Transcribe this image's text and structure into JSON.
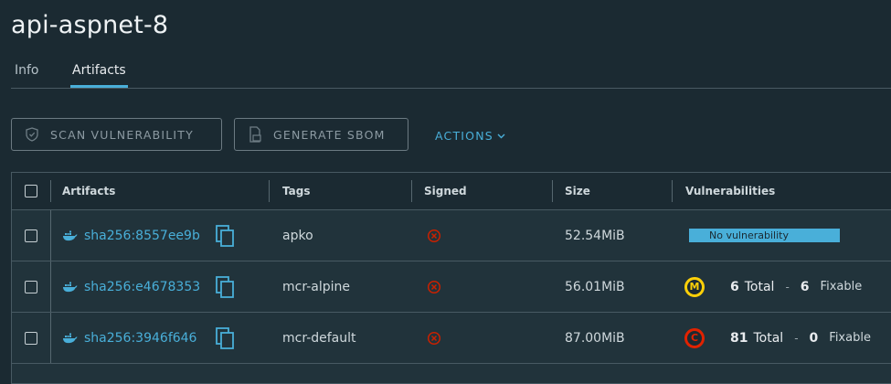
{
  "page": {
    "title": "api-aspnet-8"
  },
  "tabs": [
    {
      "label": "Info"
    },
    {
      "label": "Artifacts"
    }
  ],
  "toolbar": {
    "scan_label": "SCAN VULNERABILITY",
    "sbom_label": "GENERATE SBOM",
    "actions_label": "ACTIONS"
  },
  "table": {
    "headers": [
      "Artifacts",
      "Tags",
      "Signed",
      "Size",
      "Vulnerabilities"
    ],
    "rows": [
      {
        "digest": "sha256:8557ee9b",
        "tag": "apko",
        "size": "52.54MiB",
        "vuln": {
          "type": "none",
          "label": "No vulnerability"
        }
      },
      {
        "digest": "sha256:e4678353",
        "tag": "mcr-alpine",
        "size": "56.01MiB",
        "vuln": {
          "type": "medium",
          "severity": "M",
          "total": "6",
          "total_label": "Total",
          "dash": "-",
          "fixable": "6",
          "fixable_label": "Fixable"
        }
      },
      {
        "digest": "sha256:3946f646",
        "tag": "mcr-default",
        "size": "87.00MiB",
        "vuln": {
          "type": "critical",
          "severity": "C",
          "total": "81",
          "total_label": "Total",
          "dash": "-",
          "fixable": "0",
          "fixable_label": "Fixable"
        }
      }
    ]
  },
  "colors": {
    "accent": "#49afd9",
    "medium": "#fdd008",
    "critical": "#e12200",
    "unsigned": "#c92100"
  },
  "icons": {
    "scan": "shield-icon",
    "sbom": "document-icon",
    "artifact": "docker-whale-icon",
    "copy": "copy-icon",
    "signed": "not-signed-icon"
  }
}
